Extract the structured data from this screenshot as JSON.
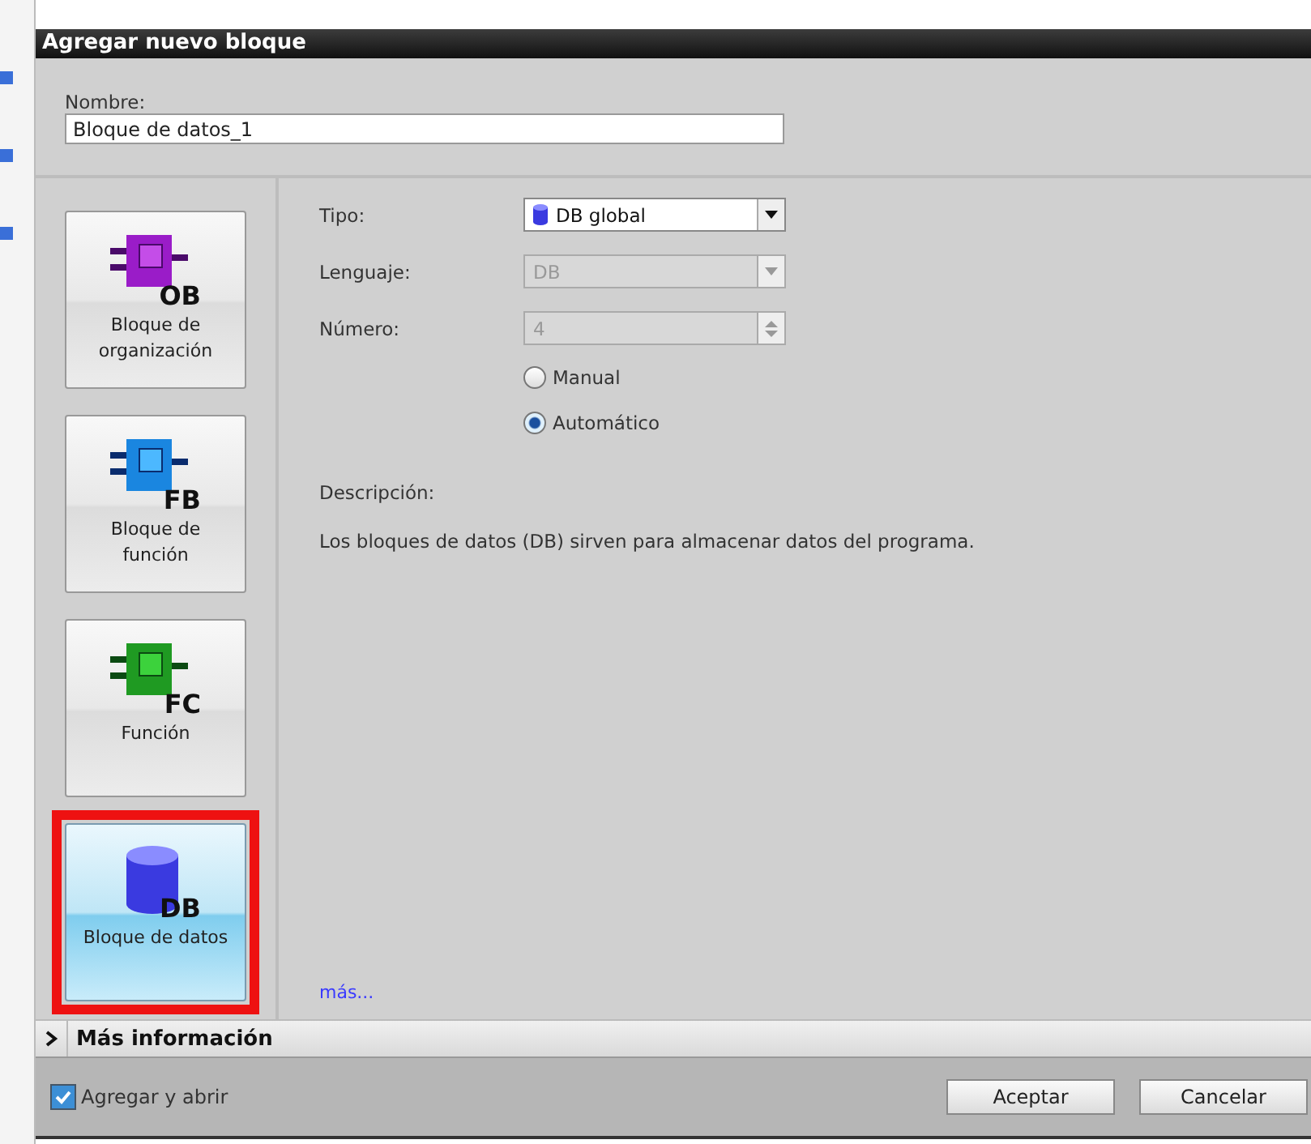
{
  "window": {
    "title": "Agregar nuevo bloque"
  },
  "name_field": {
    "label": "Nombre:",
    "value": "Bloque de datos_1"
  },
  "block_types": [
    {
      "kind": "ob",
      "badge": "OB",
      "label": "Bloque de organización",
      "selected": false
    },
    {
      "kind": "fb",
      "badge": "FB",
      "label": "Bloque de función",
      "selected": false
    },
    {
      "kind": "fc",
      "badge": "FC",
      "label": "Función",
      "selected": false
    },
    {
      "kind": "db",
      "badge": "DB",
      "label": "Bloque de datos",
      "selected": true
    }
  ],
  "form": {
    "type_label": "Tipo:",
    "type_value": "DB global",
    "language_label": "Lenguaje:",
    "language_value": "DB",
    "language_disabled": true,
    "number_label": "Número:",
    "number_value": "4",
    "number_disabled": true,
    "radios": [
      {
        "label": "Manual",
        "selected": false
      },
      {
        "label": "Automático",
        "selected": true
      }
    ],
    "description_label": "Descripción:",
    "description": "Los bloques de datos (DB) sirven para almacenar datos del programa.",
    "more_link": "más..."
  },
  "more_info": {
    "label": "Más información",
    "expanded": false
  },
  "footer": {
    "checkbox": {
      "label": "Agregar y abrir",
      "checked": true
    },
    "buttons": [
      "Aceptar",
      "Cancelar"
    ]
  }
}
